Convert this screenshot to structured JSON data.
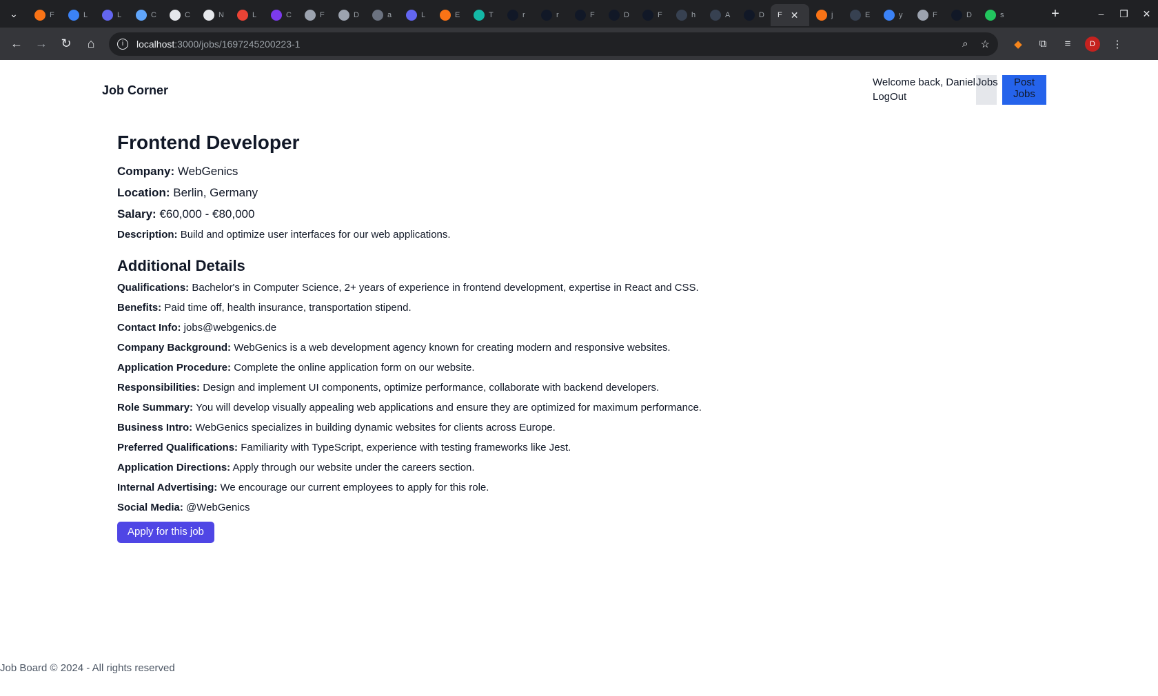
{
  "browser": {
    "tabs": [
      {
        "letter": "F",
        "color": "#f97316"
      },
      {
        "letter": "L",
        "color": "#3b82f6"
      },
      {
        "letter": "L",
        "color": "#6366f1"
      },
      {
        "letter": "C",
        "color": "#60a5fa"
      },
      {
        "letter": "C",
        "color": "#e5e7eb"
      },
      {
        "letter": "N",
        "color": "#e5e7eb"
      },
      {
        "letter": "L",
        "color": "#ea4335"
      },
      {
        "letter": "C",
        "color": "#7c3aed"
      },
      {
        "letter": "F",
        "color": "#9ca3af"
      },
      {
        "letter": "D",
        "color": "#9ca3af"
      },
      {
        "letter": "a",
        "color": "#6b7280"
      },
      {
        "letter": "L",
        "color": "#6366f1"
      },
      {
        "letter": "E",
        "color": "#f97316"
      },
      {
        "letter": "T",
        "color": "#14b8a6"
      },
      {
        "letter": "r",
        "color": "#111827"
      },
      {
        "letter": "r",
        "color": "#111827"
      },
      {
        "letter": "F",
        "color": "#111827"
      },
      {
        "letter": "D",
        "color": "#111827"
      },
      {
        "letter": "F",
        "color": "#111827"
      },
      {
        "letter": "h",
        "color": "#374151"
      },
      {
        "letter": "A",
        "color": "#374151"
      },
      {
        "letter": "D",
        "color": "#111827"
      }
    ],
    "active_tab_letter": "F",
    "tabs_after": [
      {
        "letter": "j",
        "color": "#f97316"
      },
      {
        "letter": "E",
        "color": "#374151"
      },
      {
        "letter": "y",
        "color": "#3b82f6"
      },
      {
        "letter": "F",
        "color": "#9ca3af"
      },
      {
        "letter": "D",
        "color": "#111827"
      },
      {
        "letter": "s",
        "color": "#22c55e"
      }
    ],
    "url_host": "localhost",
    "url_path": ":3000/jobs/1697245200223-1",
    "profile_initial": "D"
  },
  "header": {
    "brand": "Job Corner",
    "welcome": "Welcome back, Daniel",
    "logout": "LogOut",
    "jobs_label": "Jobs",
    "post_jobs_label": "Post Jobs"
  },
  "job": {
    "title": "Frontend Developer",
    "company_label": "Company:",
    "company": "WebGenics",
    "location_label": "Location:",
    "location": "Berlin, Germany",
    "salary_label": "Salary:",
    "salary": "€60,000 - €80,000",
    "description_label": "Description:",
    "description": "Build and optimize user interfaces for our web applications.",
    "additional_heading": "Additional Details",
    "details": [
      {
        "label": "Qualifications:",
        "value": "Bachelor's in Computer Science, 2+ years of experience in frontend development, expertise in React and CSS."
      },
      {
        "label": "Benefits:",
        "value": "Paid time off, health insurance, transportation stipend."
      },
      {
        "label": "Contact Info:",
        "value": "jobs@webgenics.de"
      },
      {
        "label": "Company Background:",
        "value": "WebGenics is a web development agency known for creating modern and responsive websites."
      },
      {
        "label": "Application Procedure:",
        "value": "Complete the online application form on our website."
      },
      {
        "label": "Responsibilities:",
        "value": "Design and implement UI components, optimize performance, collaborate with backend developers."
      },
      {
        "label": "Role Summary:",
        "value": "You will develop visually appealing web applications and ensure they are optimized for maximum performance."
      },
      {
        "label": "Business Intro:",
        "value": "WebGenics specializes in building dynamic websites for clients across Europe."
      },
      {
        "label": "Preferred Qualifications:",
        "value": "Familiarity with TypeScript, experience with testing frameworks like Jest."
      },
      {
        "label": "Application Directions:",
        "value": "Apply through our website under the careers section."
      },
      {
        "label": "Internal Advertising:",
        "value": "We encourage our current employees to apply for this role."
      },
      {
        "label": "Social Media:",
        "value": "@WebGenics"
      }
    ],
    "apply_label": "Apply for this job"
  },
  "footer": {
    "text": "Job Board © 2024 - All rights reserved"
  }
}
